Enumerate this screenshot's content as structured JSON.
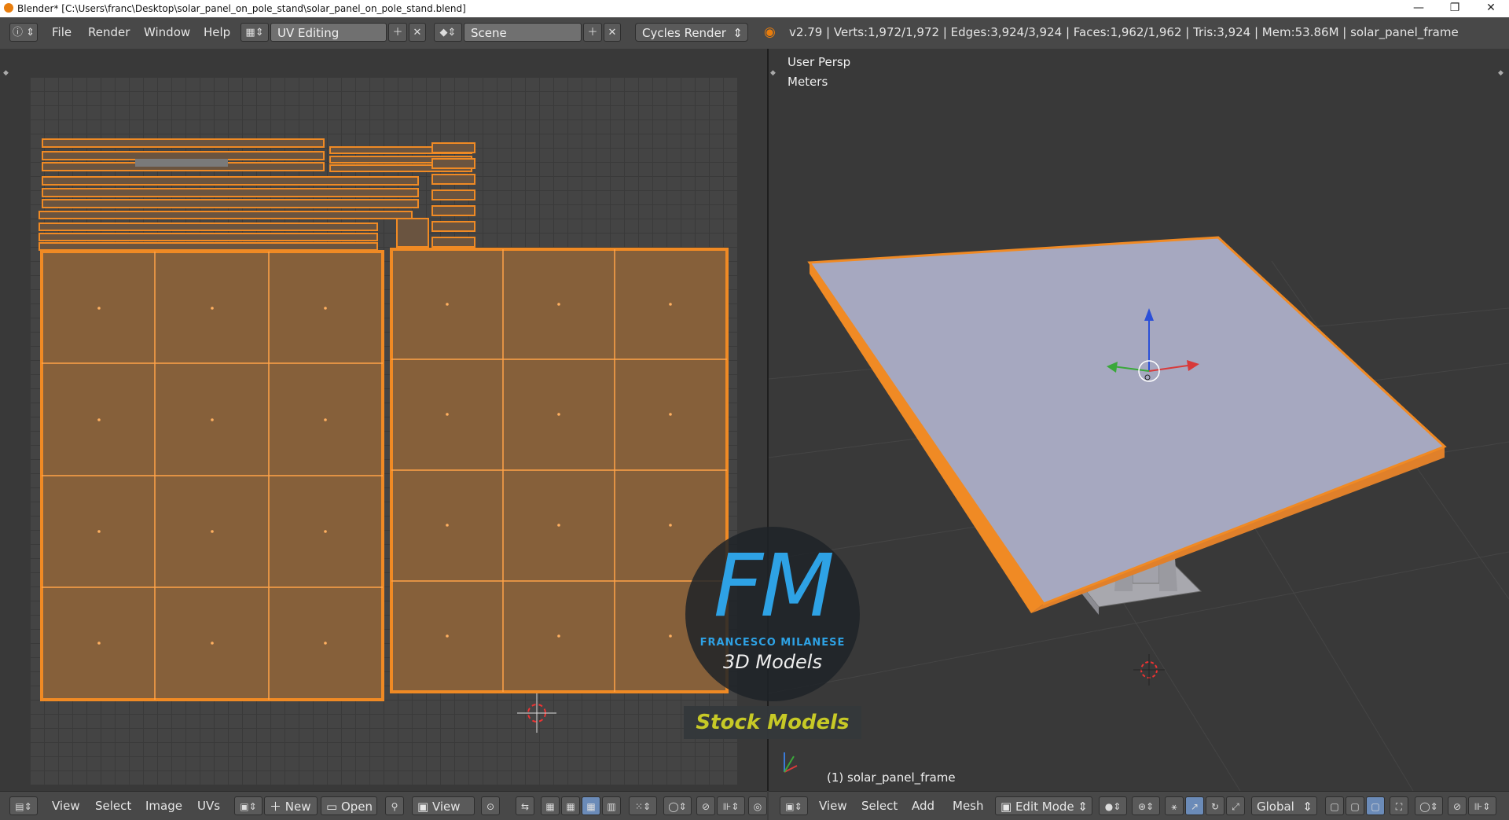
{
  "window": {
    "title": "Blender* [C:\\Users\\franc\\Desktop\\solar_panel_on_pole_stand\\solar_panel_on_pole_stand.blend]",
    "controls": {
      "minimize": "—",
      "restore": "❐",
      "close": "✕"
    }
  },
  "info_header": {
    "menus": [
      "File",
      "Render",
      "Window",
      "Help"
    ],
    "screen_layout": "UV Editing",
    "scene": "Scene",
    "render_engine": "Cycles Render",
    "stats": "v2.79 | Verts:1,972/1,972 | Edges:3,924/3,924 | Faces:1,962/1,962 | Tris:3,924 | Mem:53.86M | solar_panel_frame"
  },
  "viewport": {
    "view_name": "User Persp",
    "units": "Meters",
    "object_label": "(1) solar_panel_frame"
  },
  "uv_footer": {
    "menus": [
      "View",
      "Select",
      "Image",
      "UVs"
    ],
    "new_label": "New",
    "open_label": "Open",
    "view_label": "View"
  },
  "vp_footer": {
    "menus": [
      "View",
      "Select",
      "Add",
      "Mesh"
    ],
    "mode": "Edit Mode",
    "orientation": "Global"
  },
  "watermark": {
    "logo": "FM",
    "name": "FRANCESCO MILANESE",
    "tagline": "3D Models",
    "badge": "Stock Models"
  },
  "colors": {
    "selection": "#f08a24",
    "uv_face": "#86603a",
    "panel_top": "#a6a8c0",
    "accent_blue": "#2ea2e5",
    "badge_yellow": "#cfd126"
  }
}
